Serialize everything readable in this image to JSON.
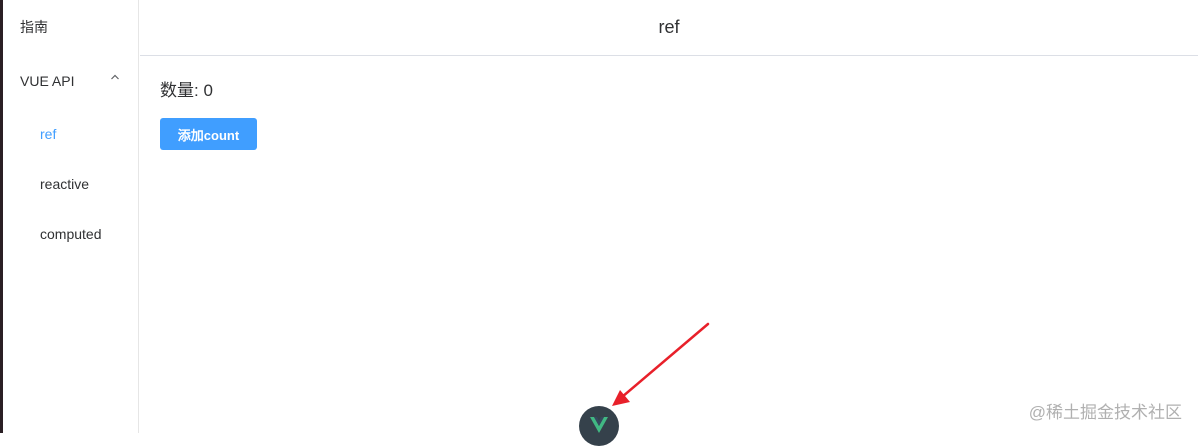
{
  "sidebar": {
    "guide_label": "指南",
    "group_label": "VUE API",
    "items": [
      {
        "label": "ref",
        "active": true
      },
      {
        "label": "reactive",
        "active": false
      },
      {
        "label": "computed",
        "active": false
      }
    ]
  },
  "header": {
    "title": "ref"
  },
  "main": {
    "count_text": "数量: 0",
    "add_button_label": "添加count"
  },
  "watermark": {
    "text": "@稀土掘金技术社区"
  },
  "colors": {
    "accent": "#409eff",
    "arrow": "#e8202a",
    "devtools_bg": "#35414b",
    "vue_green": "#41b883"
  },
  "icons": {
    "group_toggle": "chevron-up-icon",
    "devtools": "vue-logo-icon",
    "annotation": "red-arrow-icon"
  }
}
